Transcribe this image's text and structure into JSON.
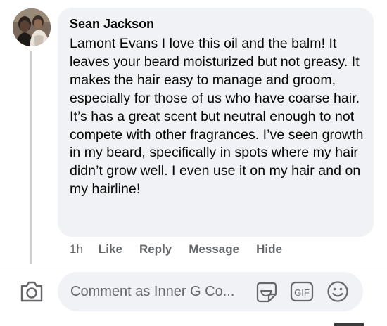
{
  "comment": {
    "author": "Sean Jackson",
    "text": "Lamont Evans I love this oil and the balm! It leaves your beard moisturized but not greasy. It makes the hair easy to manage and groom, especially for those of us who have coarse hair. It’s has a great scent but neutral enough to not compete with other fragrances. I’ve seen growth in my beard, specifically in spots where my hair didn’t grow well. I even use it on my hair and on my hairline!",
    "time": "1h",
    "actions": {
      "like": "Like",
      "reply": "Reply",
      "message": "Message",
      "hide": "Hide"
    }
  },
  "composer": {
    "placeholder": "Comment as Inner G Co...",
    "gif_label": "GIF",
    "icons": [
      "camera-icon",
      "sticker-icon",
      "gif-icon",
      "emoji-icon"
    ]
  },
  "colors": {
    "bubble_bg": "#f0f2f5",
    "secondary_text": "#65676b",
    "primary_text": "#050505",
    "thread_line": "#ced0d4"
  }
}
